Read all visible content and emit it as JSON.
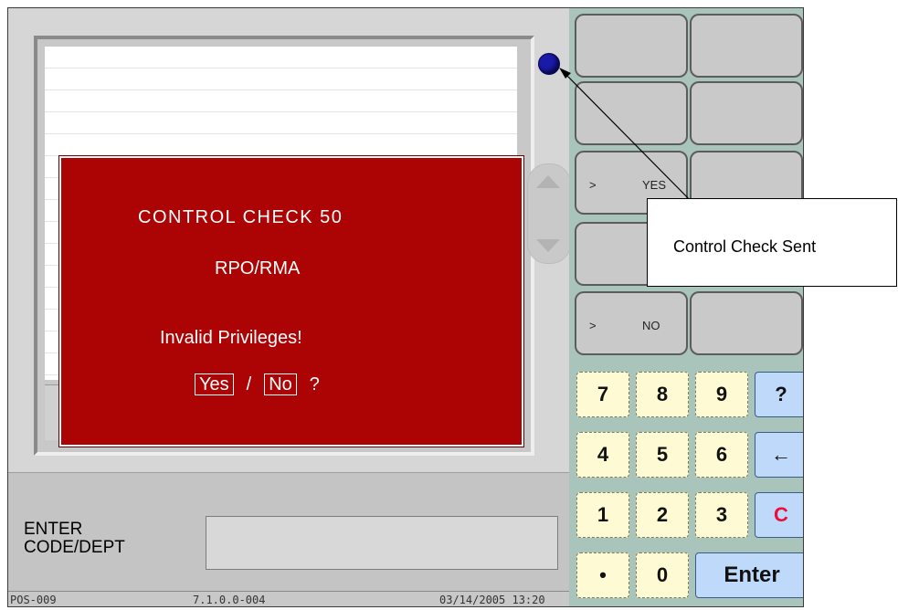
{
  "modal": {
    "line1": "CONTROL  CHECK  50",
    "line2": "RPO/RMA",
    "line3": "Invalid  Privileges!",
    "yes_label": "Yes",
    "slash": "/",
    "no_label": "No",
    "question": "?"
  },
  "prompt": {
    "line1": "ENTER",
    "line2": "CODE/DEPT"
  },
  "entry_value": "",
  "statusbar": {
    "terminal": "POS-009",
    "version": "7.1.0.0-004",
    "datetime": "03/14/2005 13:20"
  },
  "function_keys": [
    {
      "arrow": "",
      "label": ""
    },
    {
      "arrow": "",
      "label": ""
    },
    {
      "arrow": "",
      "label": ""
    },
    {
      "arrow": "",
      "label": ""
    },
    {
      "arrow": ">",
      "label": "YES"
    },
    {
      "arrow": "",
      "label": ""
    },
    {
      "arrow": "",
      "label": ""
    },
    {
      "arrow": "",
      "label": ""
    },
    {
      "arrow": ">",
      "label": "NO"
    },
    {
      "arrow": "",
      "label": ""
    }
  ],
  "keypad": {
    "k7": "7",
    "k8": "8",
    "k9": "9",
    "help": "?",
    "k4": "4",
    "k5": "5",
    "k6": "6",
    "backspace": "←",
    "k1": "1",
    "k2": "2",
    "k3": "3",
    "clear": "C",
    "dot": "•",
    "k0": "0",
    "enter": "Enter"
  },
  "callout": {
    "text": "Control Check Sent"
  },
  "colors": {
    "modal_bg": "#ac0404",
    "keypanel_bg": "#a9c4ba",
    "numkey_bg": "#fefbd4",
    "funckey_bg": "#bfd9fb",
    "status_dot": "#1a1aa8",
    "clear_key_text": "#e8103a"
  },
  "icons": {
    "status_indicator": "blue-dot-icon",
    "backspace": "left-arrow-icon",
    "scroll_up": "triangle-up-icon",
    "scroll_down": "triangle-down-icon"
  }
}
